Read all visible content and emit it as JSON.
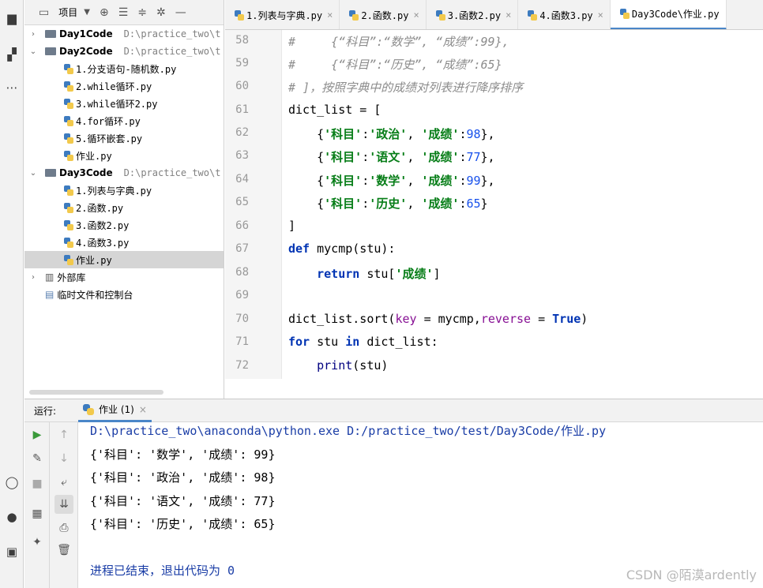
{
  "project": {
    "title": "项目",
    "tree": [
      {
        "type": "folder",
        "name": "Day1Code",
        "path": "D:\\practice_two\\t",
        "expanded": false,
        "level": 0
      },
      {
        "type": "folder",
        "name": "Day2Code",
        "path": "D:\\practice_two\\t",
        "expanded": true,
        "level": 0
      },
      {
        "type": "file",
        "name": "1.分支语句-随机数.py",
        "level": 1
      },
      {
        "type": "file",
        "name": "2.while循环.py",
        "level": 1
      },
      {
        "type": "file",
        "name": "3.while循环2.py",
        "level": 1
      },
      {
        "type": "file",
        "name": "4.for循环.py",
        "level": 1
      },
      {
        "type": "file",
        "name": "5.循环嵌套.py",
        "level": 1
      },
      {
        "type": "file",
        "name": "作业.py",
        "level": 1
      },
      {
        "type": "folder",
        "name": "Day3Code",
        "path": "D:\\practice_two\\t",
        "expanded": true,
        "level": 0
      },
      {
        "type": "file",
        "name": "1.列表与字典.py",
        "level": 1
      },
      {
        "type": "file",
        "name": "2.函数.py",
        "level": 1
      },
      {
        "type": "file",
        "name": "3.函数2.py",
        "level": 1
      },
      {
        "type": "file",
        "name": "4.函数3.py",
        "level": 1
      },
      {
        "type": "file",
        "name": "作业.py",
        "level": 1,
        "selected": true
      },
      {
        "type": "lib",
        "name": "外部库",
        "level": 0
      },
      {
        "type": "scratch",
        "name": "临时文件和控制台",
        "level": 0
      }
    ]
  },
  "tabs": [
    {
      "label": "1.列表与字典.py"
    },
    {
      "label": "2.函数.py"
    },
    {
      "label": "3.函数2.py"
    },
    {
      "label": "4.函数3.py"
    },
    {
      "label": "Day3Code\\作业.py",
      "active": true
    }
  ],
  "editor": {
    "line_numbers": [
      "58",
      "59",
      "60",
      "61",
      "62",
      "63",
      "64",
      "65",
      "66",
      "67",
      "68",
      "69",
      "70",
      "71",
      "72"
    ]
  },
  "run": {
    "label": "运行:",
    "tab": "作业 (1)",
    "command": "D:\\practice_two\\anaconda\\python.exe D:/practice_two/test/Day3Code/作业.py",
    "output": [
      "{'科目': '数学', '成绩': 99}",
      "{'科目': '政治', '成绩': 98}",
      "{'科目': '语文', '成绩': 77}",
      "{'科目': '历史', '成绩': 65}"
    ],
    "exit_message": "进程已结束，退出代码为 0"
  },
  "watermark": "CSDN @陌漠ardently"
}
